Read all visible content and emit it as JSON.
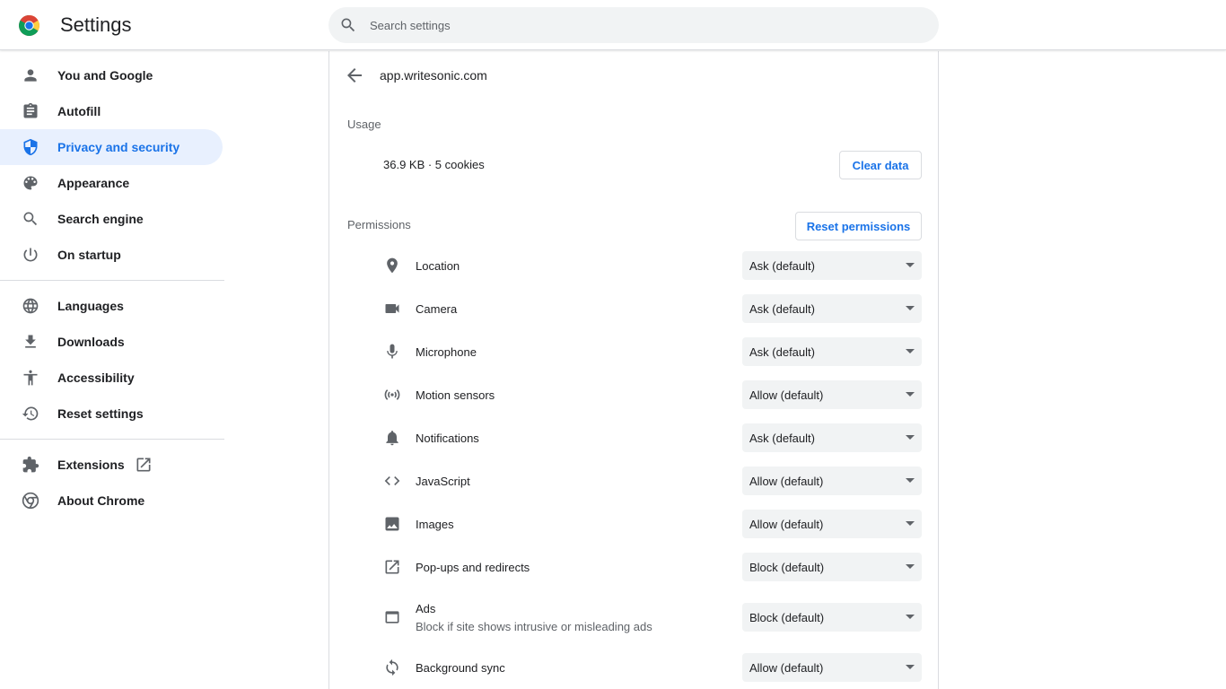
{
  "header": {
    "app_title": "Settings",
    "search_placeholder": "Search settings"
  },
  "sidebar": {
    "items": [
      {
        "label": "You and Google",
        "icon": "person-icon"
      },
      {
        "label": "Autofill",
        "icon": "assignment-icon"
      },
      {
        "label": "Privacy and security",
        "icon": "shield-icon",
        "active": true
      },
      {
        "label": "Appearance",
        "icon": "palette-icon"
      },
      {
        "label": "Search engine",
        "icon": "search-icon"
      },
      {
        "label": "On startup",
        "icon": "power-icon"
      },
      {
        "label": "Languages",
        "icon": "globe-icon"
      },
      {
        "label": "Downloads",
        "icon": "download-icon"
      },
      {
        "label": "Accessibility",
        "icon": "accessibility-icon"
      },
      {
        "label": "Reset settings",
        "icon": "history-icon"
      },
      {
        "label": "Extensions",
        "icon": "puzzle-icon"
      },
      {
        "label": "About Chrome",
        "icon": "chrome-icon"
      }
    ]
  },
  "site": {
    "title": "app.writesonic.com",
    "usage_label": "Usage",
    "usage_value": "36.9 KB · 5 cookies",
    "clear_data_label": "Clear data",
    "permissions_label": "Permissions",
    "reset_permissions_label": "Reset permissions",
    "permissions": [
      {
        "label": "Location",
        "value": "Ask (default)",
        "icon": "location-pin-icon"
      },
      {
        "label": "Camera",
        "value": "Ask (default)",
        "icon": "camera-icon"
      },
      {
        "label": "Microphone",
        "value": "Ask (default)",
        "icon": "microphone-icon"
      },
      {
        "label": "Motion sensors",
        "value": "Allow (default)",
        "icon": "sensors-icon"
      },
      {
        "label": "Notifications",
        "value": "Ask (default)",
        "icon": "bell-icon"
      },
      {
        "label": "JavaScript",
        "value": "Allow (default)",
        "icon": "code-icon"
      },
      {
        "label": "Images",
        "value": "Allow (default)",
        "icon": "image-icon"
      },
      {
        "label": "Pop-ups and redirects",
        "value": "Block (default)",
        "icon": "open-in-new-icon"
      },
      {
        "label": "Ads",
        "sublabel": "Block if site shows intrusive or misleading ads",
        "value": "Block (default)",
        "icon": "web-asset-icon"
      },
      {
        "label": "Background sync",
        "value": "Allow (default)",
        "icon": "sync-icon"
      }
    ]
  },
  "colors": {
    "accent": "#1a73e8",
    "active_bg": "#e8f0fe",
    "icon": "#5f6368"
  }
}
